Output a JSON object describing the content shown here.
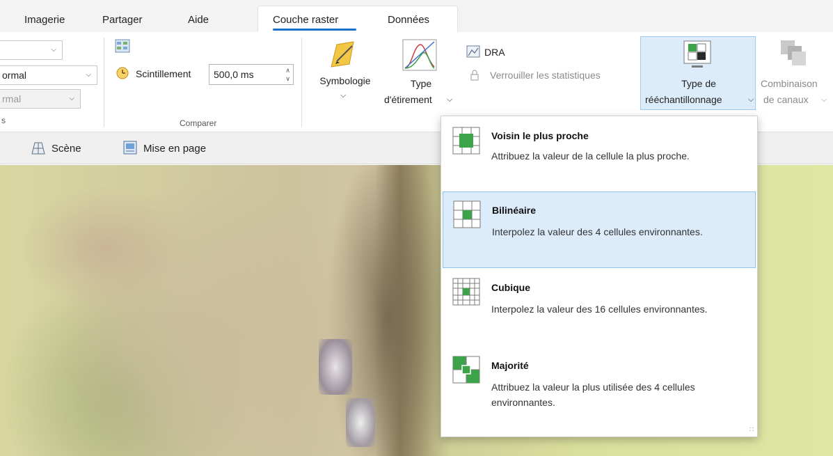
{
  "tabs": {
    "imagerie": "Imagerie",
    "partager": "Partager",
    "aide": "Aide",
    "couche_raster": "Couche raster",
    "donnees": "Données"
  },
  "ribbon": {
    "blend_value": "ormal",
    "blend_value_disabled": "rmal",
    "group_left_label": "s",
    "flicker_label": "Scintillement",
    "flicker_value": "500,0  ms",
    "compare_label": "Comparer",
    "symbologie": "Symbologie",
    "type_etirement_line1": "Type",
    "type_etirement_line2": "d'étirement",
    "dra": "DRA",
    "lock_stats": "Verrouiller les statistiques",
    "resample_line1": "Type de",
    "resample_line2": "rééchantillonnage",
    "combine_line1": "Combinaison",
    "combine_line2": "de canaux"
  },
  "views": {
    "scene": "Scène",
    "layout": "Mise en page"
  },
  "menu": {
    "items": [
      {
        "title": "Voisin le plus proche",
        "desc": "Attribuez la valeur de la cellule la plus proche.",
        "icon": "nearest-neighbor-icon"
      },
      {
        "title": "Bilinéaire",
        "desc": "Interpolez la valeur des 4 cellules environnantes.",
        "icon": "bilinear-icon"
      },
      {
        "title": "Cubique",
        "desc": "Interpolez la valeur des 16 cellules environnantes.",
        "icon": "cubic-icon"
      },
      {
        "title": "Majorité",
        "desc": "Attribuez la valeur la plus utilisée des 4 cellules environnantes.",
        "icon": "majority-icon"
      }
    ],
    "selected": "Bilinéaire"
  },
  "colors": {
    "accent": "#1e6fc9",
    "highlight": "#dcecfb",
    "cell_green": "#3da34a"
  }
}
